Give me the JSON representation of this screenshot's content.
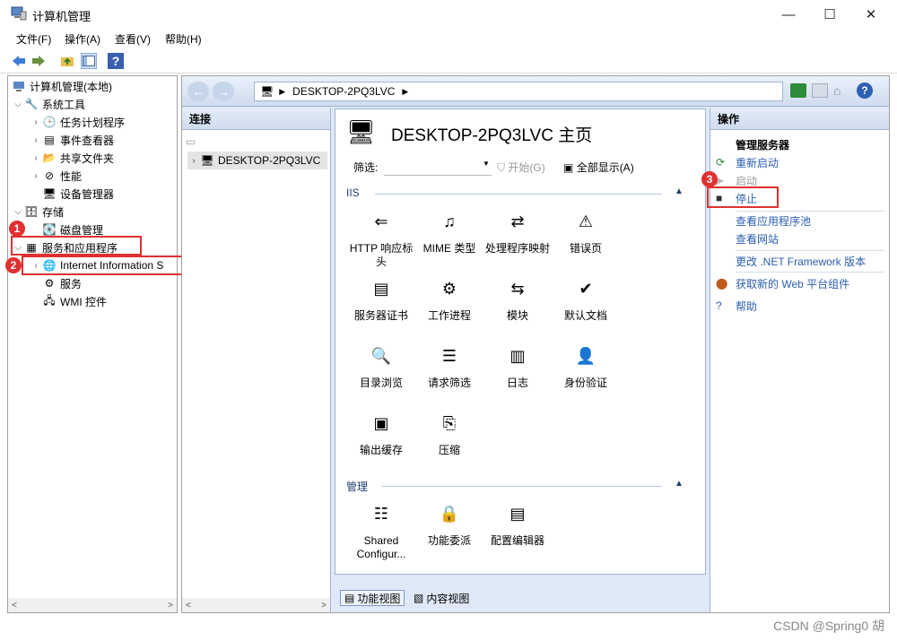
{
  "window": {
    "title": "计算机管理",
    "controls": {
      "minimize": "—",
      "maximize": "☐",
      "close": "✕"
    }
  },
  "menu": [
    "文件(F)",
    "操作(A)",
    "查看(V)",
    "帮助(H)"
  ],
  "tree": {
    "root": "计算机管理(本地)",
    "items": [
      {
        "label": "系统工具"
      },
      {
        "label": "任务计划程序"
      },
      {
        "label": "事件查看器"
      },
      {
        "label": "共享文件夹"
      },
      {
        "label": "性能"
      },
      {
        "label": "设备管理器"
      },
      {
        "label": "存储"
      },
      {
        "label": "磁盘管理"
      },
      {
        "label": "服务和应用程序"
      },
      {
        "label": "Internet Information S"
      },
      {
        "label": "服务"
      },
      {
        "label": "WMI 控件"
      }
    ],
    "scroll_left": "<",
    "scroll_right": ">"
  },
  "iis": {
    "address": "DESKTOP-2PQ3LVC",
    "connections": {
      "title": "连接",
      "server_node": "DESKTOP-2PQ3LVC"
    },
    "center": {
      "title": "DESKTOP-2PQ3LVC 主页",
      "filter_label": "筛选:",
      "start_label": "开始(G)",
      "show_all_label": "全部显示(A)",
      "group_iis": "IIS",
      "group_manage": "管理",
      "iis_features": [
        "HTTP 响应标头",
        "MIME 类型",
        "处理程序映射",
        "错误页",
        "服务器证书",
        "工作进程",
        "模块",
        "默认文档",
        "目录浏览",
        "请求筛选",
        "日志",
        "身份验证",
        "输出缓存",
        "压缩"
      ],
      "manage_features": [
        "Shared Configur...",
        "功能委派",
        "配置编辑器"
      ],
      "view_features": "功能视图",
      "view_content": "内容视图"
    },
    "actions": {
      "title": "操作",
      "section": "管理服务器",
      "restart": "重新启动",
      "start": "启动",
      "stop": "停止",
      "view_pools": "查看应用程序池",
      "view_sites": "查看网站",
      "change_net": "更改 .NET Framework 版本",
      "get_components": "获取新的 Web 平台组件",
      "help": "帮助"
    }
  },
  "annotations": {
    "badge1": "1",
    "badge2": "2",
    "badge3": "3"
  },
  "watermark": "CSDN @Spring0 胡",
  "colors": {
    "annotation": "#e03030",
    "link": "#2a5db0",
    "panel": "#dfe8f6"
  }
}
